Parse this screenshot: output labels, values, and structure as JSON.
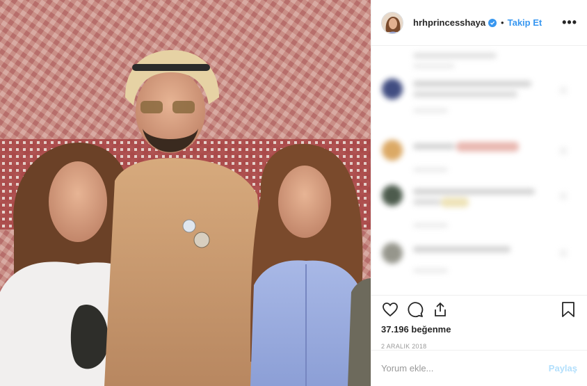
{
  "header": {
    "username": "hrhprincesshaya",
    "dot": "•",
    "follow_label": "Takip Et",
    "more_label": "•••"
  },
  "post": {
    "likes": "37.196 beğenme",
    "date": "2 ARALIK 2018"
  },
  "comment_form": {
    "placeholder": "Yorum ekle...",
    "post_label": "Paylaş"
  },
  "icons": {
    "like": "heart-icon",
    "comment": "comment-icon",
    "share": "share-icon",
    "save": "bookmark-icon",
    "verified": "verified-badge-icon"
  },
  "colors": {
    "accent": "#3897f0",
    "text": "#262626",
    "muted": "#999999",
    "post_disabled": "#b2dffc"
  }
}
